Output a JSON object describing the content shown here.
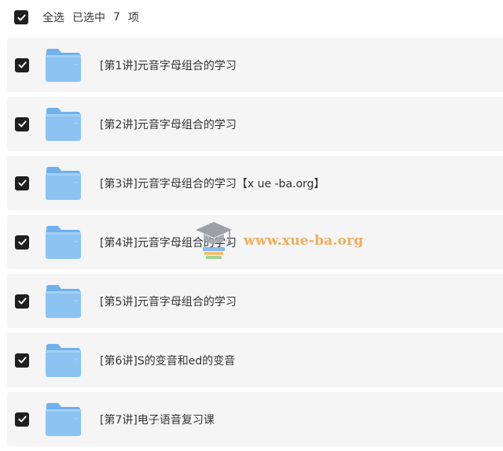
{
  "header": {
    "select_all_label": "全选",
    "selected_prefix": "已选中",
    "selected_count": "7",
    "selected_suffix": "项"
  },
  "items": [
    {
      "name": "[第1讲]元音字母组合的学习"
    },
    {
      "name": "[第2讲]元音字母组合的学习"
    },
    {
      "name": "[第3讲]元音字母组合的学习【x ue -ba.org】"
    },
    {
      "name": "[第4讲]元音字母组合的学习"
    },
    {
      "name": "[第5讲]元音字母组合的学习"
    },
    {
      "name": "[第6讲]S的变音和ed的变音"
    },
    {
      "name": "[第7讲]电子语音复习课"
    }
  ],
  "watermark": {
    "text": "www.xue-ba.org"
  },
  "colors": {
    "checkbox": "#1f1f1f",
    "row_background": "#f5f5f6",
    "folder_body": "#8cc3f2",
    "folder_tab": "#6fb1ec",
    "watermark_text": "#f0a64a"
  },
  "icons": {
    "checkbox": "checked-checkbox-icon",
    "folder": "folder-icon",
    "watermark_logo": "graduation-cap-icon"
  }
}
